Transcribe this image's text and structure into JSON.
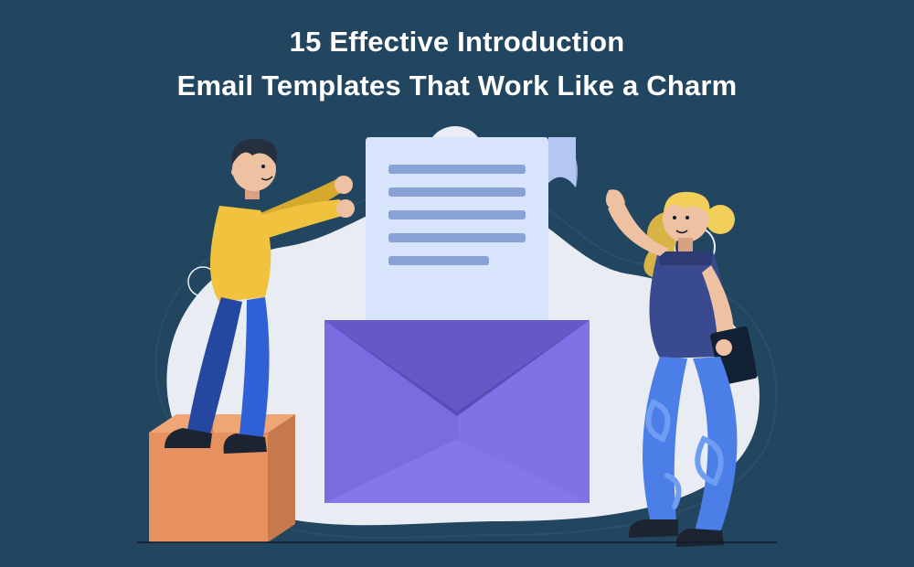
{
  "title_line1": "15 Effective Introduction",
  "title_line2": "Email Templates That Work Like a Charm",
  "colors": {
    "bg": "#234660",
    "blob": "#e9edf3",
    "blob_ring": "#2c4e67",
    "envelope_outer": "#6559c5",
    "envelope_top": "#7a6be0",
    "envelope_front": "#7f72e6",
    "envelope_flap": "#5a4bb9",
    "paper": "#d8e4fb",
    "paper_line": "#8aa3d6",
    "paper_curl": "#97a7e6",
    "signature": "#0e1a2b",
    "box": "#e6915f",
    "box_shadow": "#c6794c",
    "hair_dark": "#262f3e",
    "skin": "#efc1a3",
    "skin_shadow": "#d9a184",
    "yellow": "#f0c23e",
    "yellow_dark": "#d6a82c",
    "blue_pants": "#2f60d6",
    "blue_pants_dark": "#2448a0",
    "shoe": "#1c2331",
    "hair_blond": "#f2cf5a",
    "hair_blond_dark": "#d8b447",
    "shirt_f": "#3a4a8f",
    "shirt_f_dark": "#2d3a73",
    "pants_f": "#4c7ee8",
    "pants_f_swirl": "#6e9df2",
    "clipboard": "#112033"
  }
}
